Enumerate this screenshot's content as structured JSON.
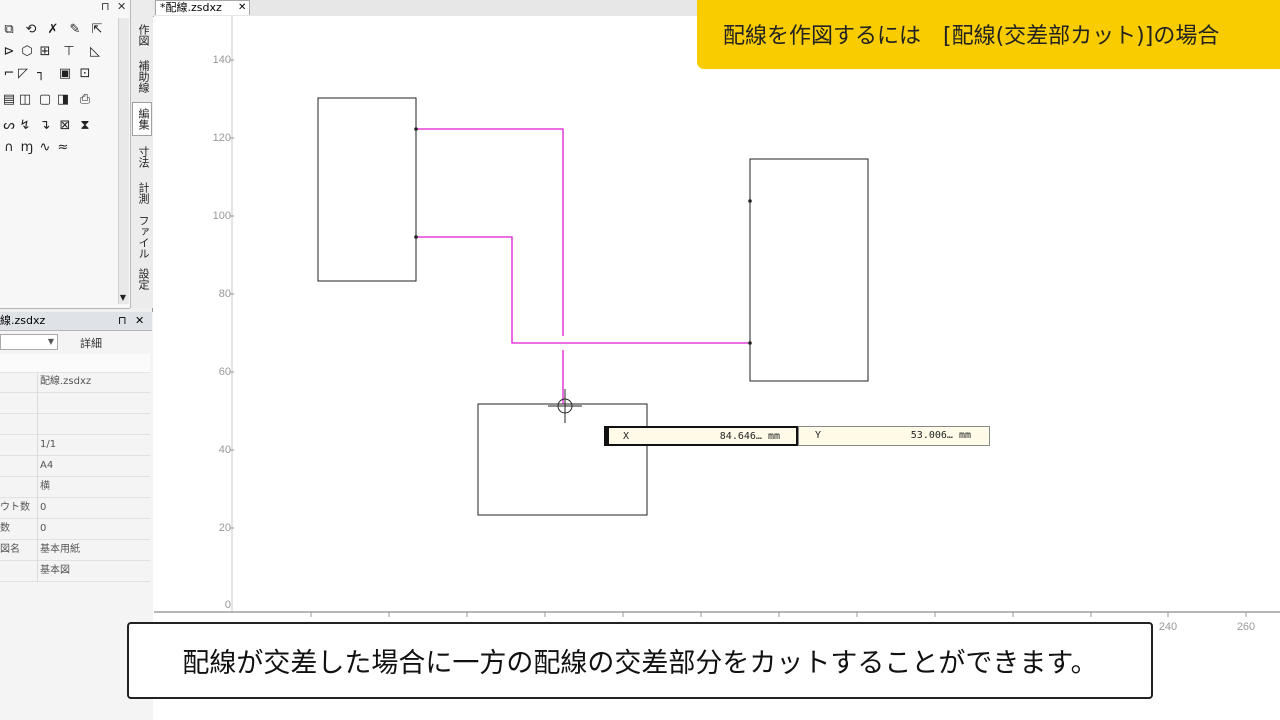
{
  "document": {
    "tab_title": "*配線.zsdxz"
  },
  "toolbox": {
    "pin_glyph": "⊓",
    "close_glyph": "✕",
    "vertical_tabs": [
      "作図",
      "補助線",
      "編集",
      "寸法",
      "計測",
      "ファイル",
      "設定"
    ],
    "active_tab_index": 2
  },
  "properties": {
    "header_title": "線.zsdxz",
    "pin_glyph": "⊓",
    "close_glyph": "✕",
    "detail_label": "詳細",
    "rows": [
      {
        "key": "",
        "value": "配線.zsdxz"
      },
      {
        "key": "",
        "value": ""
      },
      {
        "key": "",
        "value": ""
      },
      {
        "key": "",
        "value": "1/1"
      },
      {
        "key": "",
        "value": "A4"
      },
      {
        "key": "",
        "value": "横"
      },
      {
        "key": "ウト数",
        "value": "0"
      },
      {
        "key": "数",
        "value": "0"
      },
      {
        "key": "図名",
        "value": "基本用紙"
      },
      {
        "key": "",
        "value": "基本図"
      }
    ]
  },
  "ruler": {
    "y_labels": [
      "140",
      "120",
      "100",
      "80",
      "60",
      "40",
      "20",
      "0"
    ],
    "x_labels": [
      "240",
      "260"
    ]
  },
  "coordinate_readout": {
    "x_label": "X",
    "x_value": "84.646… mm",
    "y_label": "Y",
    "y_value": "53.006… mm"
  },
  "banner": {
    "text": "配線を作図するには　[配線(交差部カット)]の場合"
  },
  "caption": {
    "text": "配線が交差した場合に一方の配線の交差部分をカットすることができます。"
  },
  "colors": {
    "banner": "#f9cc00",
    "wire": "#e01bd3",
    "stroke": "#222222"
  }
}
